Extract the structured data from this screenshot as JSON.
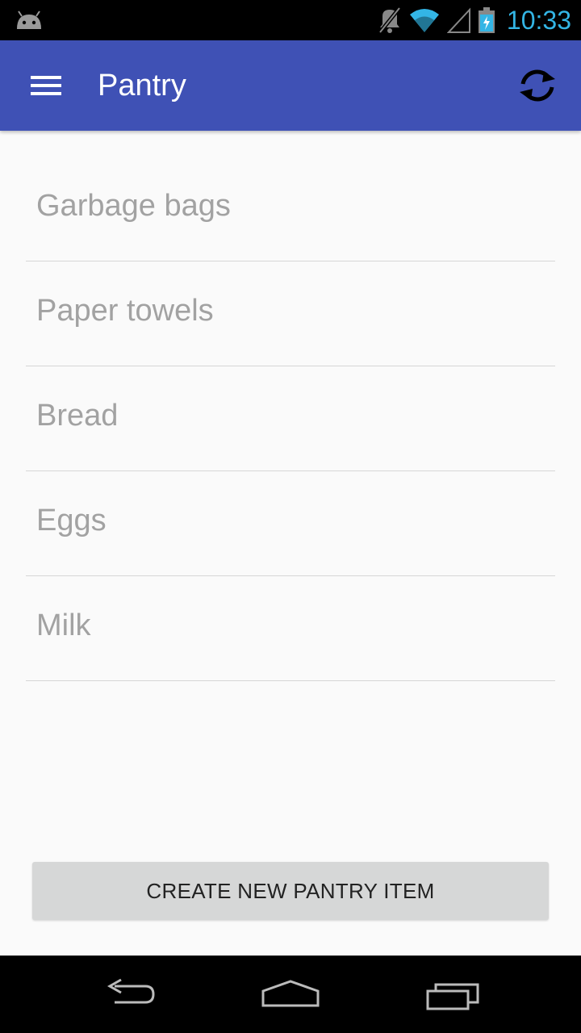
{
  "status_bar": {
    "time": "10:33",
    "icons": [
      "android-icon",
      "mute-icon",
      "wifi-icon",
      "signal-icon",
      "battery-charging-icon"
    ],
    "clock_color": "#33b5e5"
  },
  "app_bar": {
    "title": "Pantry",
    "background": "#3f51b5",
    "icons": [
      "menu-icon",
      "sync-icon"
    ]
  },
  "pantry_items": [
    {
      "label": "Garbage bags"
    },
    {
      "label": "Paper towels"
    },
    {
      "label": "Bread"
    },
    {
      "label": "Eggs"
    },
    {
      "label": "Milk"
    }
  ],
  "create_button": {
    "label": "CREATE NEW PANTRY ITEM"
  },
  "nav_bar": {
    "icons": [
      "back-icon",
      "home-icon",
      "recents-icon"
    ]
  }
}
